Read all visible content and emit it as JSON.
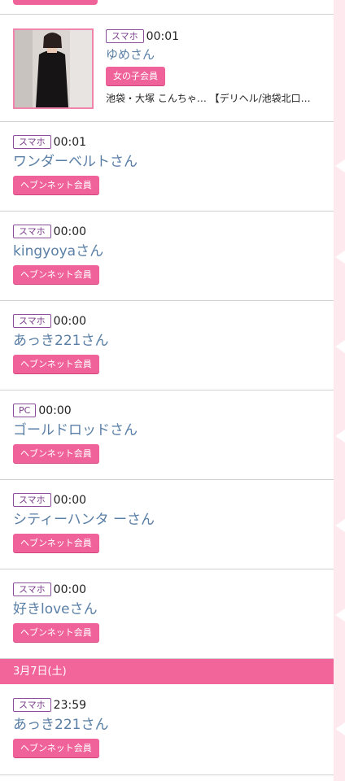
{
  "rows": [
    {
      "device": "スマホ",
      "time": "00:01",
      "name": "ゆめさん",
      "badge": "女の子会員",
      "shop": "池袋・大塚 こんちゃ… 【デリヘル/池袋北口…"
    },
    {
      "device": "スマホ",
      "time": "00:01",
      "name": "ワンダーベルトさん",
      "badge": "ヘブンネット会員"
    },
    {
      "device": "スマホ",
      "time": "00:00",
      "name": "kingyoyaさん",
      "badge": "ヘブンネット会員"
    },
    {
      "device": "スマホ",
      "time": "00:00",
      "name": "あっき221さん",
      "badge": "ヘブンネット会員"
    },
    {
      "device": "PC",
      "time": "00:00",
      "name": "ゴールドロッドさん",
      "badge": "ヘブンネット会員"
    },
    {
      "device": "スマホ",
      "time": "00:00",
      "name": "シティーハンタ ーさん",
      "badge": "ヘブンネット会員"
    },
    {
      "device": "スマホ",
      "time": "00:00",
      "name": "好きloveさん",
      "badge": "ヘブンネット会員"
    }
  ],
  "date_header": "3月7日(土)",
  "next_day_rows": [
    {
      "device": "スマホ",
      "time": "23:59",
      "name": "あっき221さん",
      "badge": "ヘブンネット会員"
    }
  ],
  "colors": {
    "accent": "#f0639a",
    "name": "#5a7fa6",
    "device_border": "#8a4f9a",
    "rail": "#fde9ee"
  }
}
